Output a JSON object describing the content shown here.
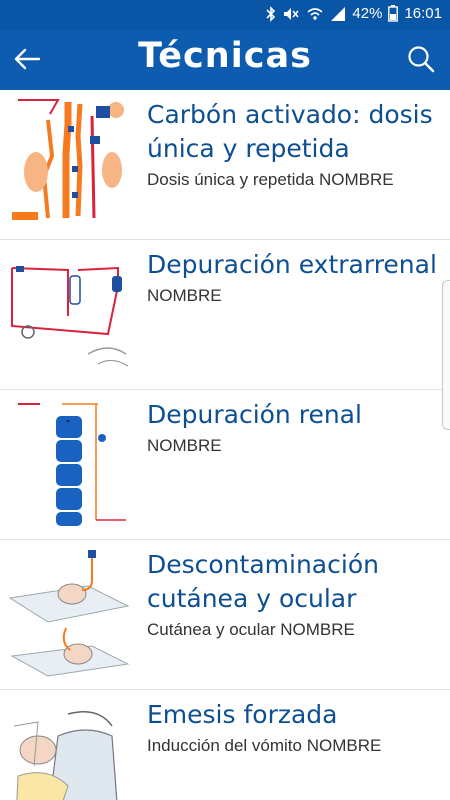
{
  "status_bar": {
    "battery": "42%",
    "time": "16:01"
  },
  "app_bar": {
    "title": "Técnicas"
  },
  "items": [
    {
      "title": "Carbón activado: dosis única y repetida",
      "subtitle": "Dosis única y repetida NOMBRE"
    },
    {
      "title": "Depuración extrarrenal",
      "subtitle": "NOMBRE"
    },
    {
      "title": "Depuración renal",
      "subtitle": "NOMBRE"
    },
    {
      "title": "Descontaminación cutánea y ocular",
      "subtitle": "Cutánea y ocular NOMBRE"
    },
    {
      "title": "Emesis forzada",
      "subtitle": "Inducción del vómito NOMBRE"
    }
  ],
  "colors": {
    "primary": "#0d5cb0",
    "status": "#0a56a6",
    "title_text": "#0d4f93",
    "accent_orange": "#f47b20",
    "accent_red": "#d8233d"
  }
}
